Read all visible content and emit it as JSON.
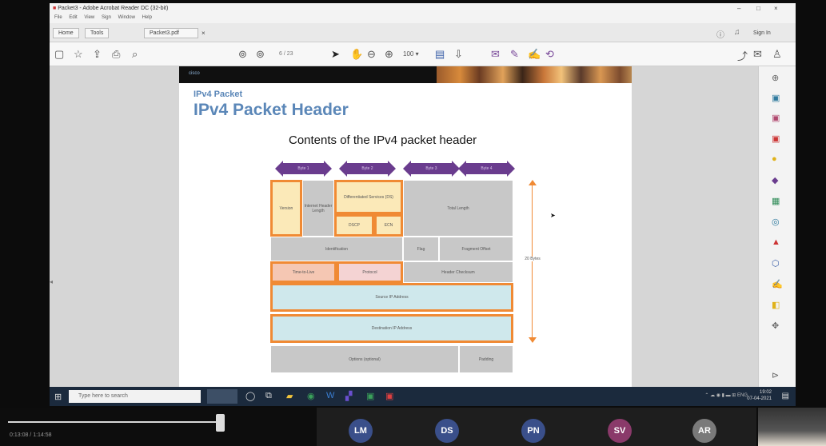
{
  "window": {
    "title": "Packet3 - Adobe Acrobat Reader DC (32-bit)",
    "menu": [
      "File",
      "Edit",
      "View",
      "Sign",
      "Window",
      "Help"
    ],
    "controls": [
      "–",
      "□",
      "×"
    ]
  },
  "tabs": [
    {
      "label": "Home"
    },
    {
      "label": "Tools"
    },
    {
      "label": "Packet3.pdf"
    }
  ],
  "toolbar": {
    "sign_in_label": "Sign In",
    "help_icon": "help-icon",
    "page_indicator": "6 / 23"
  },
  "slide": {
    "logo_text": "cisco",
    "kicker": "IPv4 Packet",
    "title": "IPv4 Packet Header",
    "subtitle": "Contents of the IPv4 packet header",
    "byte_arrows": [
      "Byte 1",
      "Byte 2",
      "Byte 3",
      "Byte 4"
    ],
    "fields": {
      "version": "Version",
      "ihl": "Internet Header Length",
      "dsf": "Differentiated Services (DS)",
      "dscp": "DSCP",
      "ecn": "ECN",
      "total_length": "Total Length",
      "identification": "Identification",
      "flag": "Flag",
      "fragment_offset": "Fragment Offset",
      "ttl": "Time-to-Live",
      "protocol": "Protocol",
      "checksum": "Header Checksum",
      "source_ip": "Source IP Address",
      "dest_ip": "Destination IP Address",
      "options": "Options (optional)",
      "padding": "Padding"
    },
    "header_size_label": "20 Bytes",
    "colors": {
      "highlight_border": "#f08a34",
      "arrow": "#6a3c8e",
      "title": "#5b87b8"
    }
  },
  "taskbar": {
    "search_placeholder": "Type here to search",
    "clock_time": "19:02",
    "clock_date": "07-04-2021"
  },
  "meeting": {
    "timecode": "0:13:08 / 1:14:58",
    "participants": [
      {
        "initials": "LM",
        "color": "#3a4f8a"
      },
      {
        "initials": "DS",
        "color": "#3a4f8a"
      },
      {
        "initials": "PN",
        "color": "#3a4f8a"
      },
      {
        "initials": "SV",
        "color": "#8a3a6a"
      },
      {
        "initials": "AR",
        "color": "#7a7a7a"
      }
    ]
  }
}
